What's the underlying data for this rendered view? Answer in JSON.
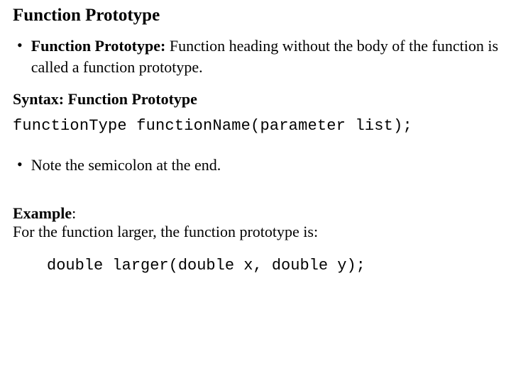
{
  "title": "Function Prototype",
  "bullet": {
    "mark": "•",
    "lead": "Function Prototype:",
    "rest": " Function heading without the body of the function is called a function prototype."
  },
  "syntax_heading": "Syntax: Function Prototype",
  "syntax_code": "functionType functionName(parameter list);",
  "note": {
    "mark": "•",
    "text": "Note the semicolon at the end."
  },
  "example": {
    "label_bold": "Example",
    "label_tail": ":",
    "intro": "For the function larger, the function prototype is:",
    "code": "double larger(double x, double y);"
  }
}
